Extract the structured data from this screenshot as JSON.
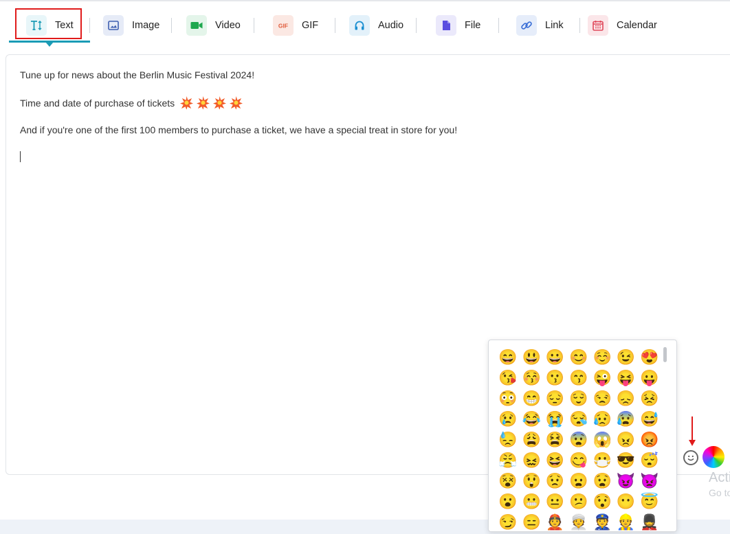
{
  "toolbar": {
    "tabs": [
      {
        "label": "Text",
        "icon": "text-icon",
        "color": "#1a9bb5",
        "bg": "#e8f6f9"
      },
      {
        "label": "Image",
        "icon": "image-icon",
        "color": "#3f5fb0",
        "bg": "#e6ebf7"
      },
      {
        "label": "Video",
        "icon": "video-icon",
        "color": "#1fa84f",
        "bg": "#e4f5ea"
      },
      {
        "label": "GIF",
        "icon": "gif-icon",
        "color": "#e05a3a",
        "bg": "#fbe8e3"
      },
      {
        "label": "Audio",
        "icon": "headphones-icon",
        "color": "#1a8fd1",
        "bg": "#e3f1fa"
      },
      {
        "label": "File",
        "icon": "file-icon",
        "color": "#5b4ee0",
        "bg": "#ebe9fb"
      },
      {
        "label": "Link",
        "icon": "link-icon",
        "color": "#3b6fd6",
        "bg": "#e6edfa"
      },
      {
        "label": "Calendar",
        "icon": "calendar-icon",
        "color": "#e0485b",
        "bg": "#fbe6e9"
      }
    ],
    "active": "Text",
    "highlight_color": "#e01b1b"
  },
  "editor": {
    "line1": "Tune up for news about the Berlin Music Festival 2024!",
    "line2": "Time and date of purchase of tickets",
    "line2_emoji_count": 4,
    "line3": "And if you're one of the first 100 members to purchase a ticket, we have a special treat in store for you!"
  },
  "emoji_picker": {
    "rows": [
      [
        "😄",
        "😃",
        "😀",
        "😊",
        "☺️",
        "😉",
        "😍"
      ],
      [
        "😘",
        "😚",
        "😗",
        "😙",
        "😜",
        "😝",
        "😛"
      ],
      [
        "😳",
        "😁",
        "😔",
        "😌",
        "😒",
        "😞",
        "😣"
      ],
      [
        "😢",
        "😂",
        "😭",
        "😪",
        "😥",
        "😰",
        "😅"
      ],
      [
        "😓",
        "😩",
        "😫",
        "😨",
        "😱",
        "😠",
        "😡"
      ],
      [
        "😤",
        "😖",
        "😆",
        "😋",
        "😷",
        "😎",
        "😴"
      ],
      [
        "😵",
        "😲",
        "😟",
        "😦",
        "😧",
        "😈",
        "👿"
      ],
      [
        "😮",
        "😬",
        "😐",
        "😕",
        "😯",
        "😶",
        "😇"
      ],
      [
        "😏",
        "😑",
        "👲",
        "👳",
        "👮",
        "👷",
        "💂"
      ]
    ]
  },
  "bottom_controls": {
    "emoji_toggle_icon": "smiley-icon",
    "color_picker_icon": "color-wheel-icon"
  },
  "watermark": {
    "line1": "Acti",
    "line2": "Go to"
  }
}
